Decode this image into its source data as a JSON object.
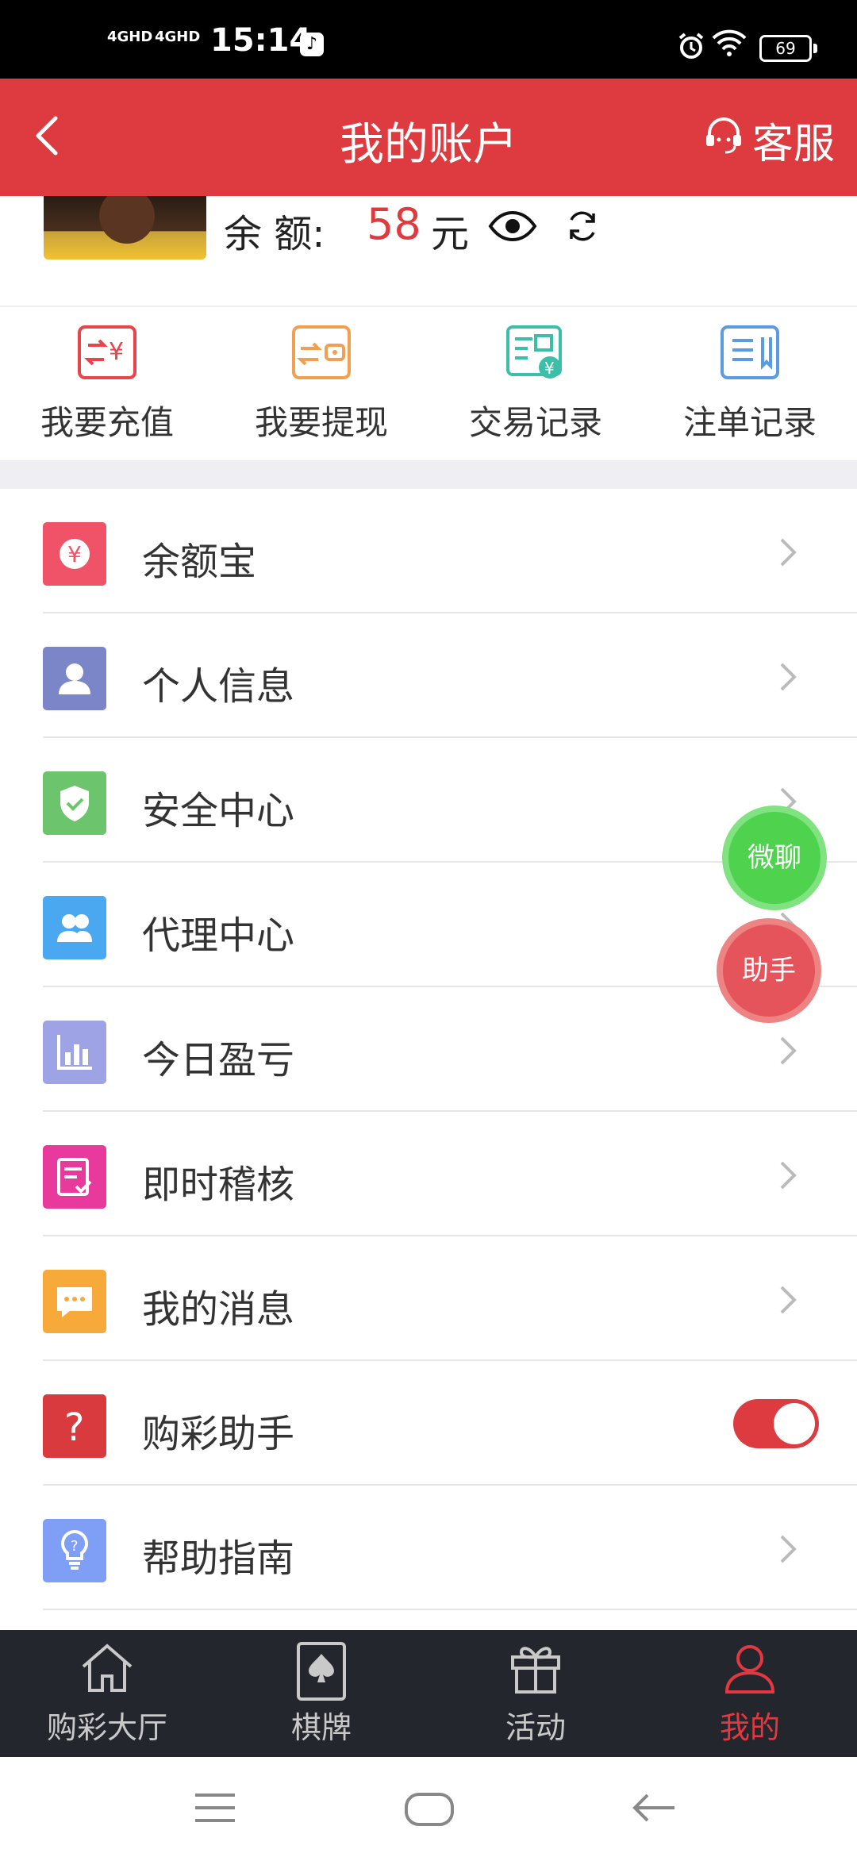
{
  "status_bar": {
    "network1": "4GHD",
    "network2": "4GHD",
    "time": "15:14",
    "battery": "69"
  },
  "header": {
    "title": "我的账户",
    "service_label": "客服"
  },
  "balance": {
    "label": "余  额:",
    "amount": "58",
    "unit": "元"
  },
  "quick_actions": [
    {
      "label": "我要充值",
      "icon": "recharge-icon",
      "color": "#e8444a"
    },
    {
      "label": "我要提现",
      "icon": "withdraw-icon",
      "color": "#f0a050"
    },
    {
      "label": "交易记录",
      "icon": "transaction-record-icon",
      "color": "#3bbfa9"
    },
    {
      "label": "注单记录",
      "icon": "bet-record-icon",
      "color": "#5b9be0"
    }
  ],
  "menu": [
    {
      "label": "余额宝",
      "icon": "yuan-icon",
      "color": "#f05368"
    },
    {
      "label": "个人信息",
      "icon": "user-icon",
      "color": "#7b86c9"
    },
    {
      "label": "安全中心",
      "icon": "shield-icon",
      "color": "#6cc56c"
    },
    {
      "label": "代理中心",
      "icon": "group-icon",
      "color": "#4aa8f0"
    },
    {
      "label": "今日盈亏",
      "icon": "bar-chart-icon",
      "color": "#9ea3e6"
    },
    {
      "label": "即时稽核",
      "icon": "audit-icon",
      "color": "#e83a9c"
    },
    {
      "label": "我的消息",
      "icon": "message-icon",
      "color": "#f7a93a"
    },
    {
      "label": "购彩助手",
      "icon": "question-icon",
      "color": "#d93a3e",
      "toggle": true
    },
    {
      "label": "帮助指南",
      "icon": "lightbulb-icon",
      "color": "#7f9ef5"
    }
  ],
  "floating": {
    "chat_label": "微聊",
    "assistant_label": "助手"
  },
  "tabbar": [
    {
      "label": "购彩大厅",
      "icon": "home-icon",
      "active": false
    },
    {
      "label": "棋牌",
      "icon": "cards-icon",
      "active": false
    },
    {
      "label": "活动",
      "icon": "gift-icon",
      "active": false
    },
    {
      "label": "我的",
      "icon": "profile-icon",
      "active": true
    }
  ],
  "colors": {
    "header_bg": "#de3b40",
    "tabbar_bg": "#23272d",
    "active_tab": "#e3383f"
  }
}
